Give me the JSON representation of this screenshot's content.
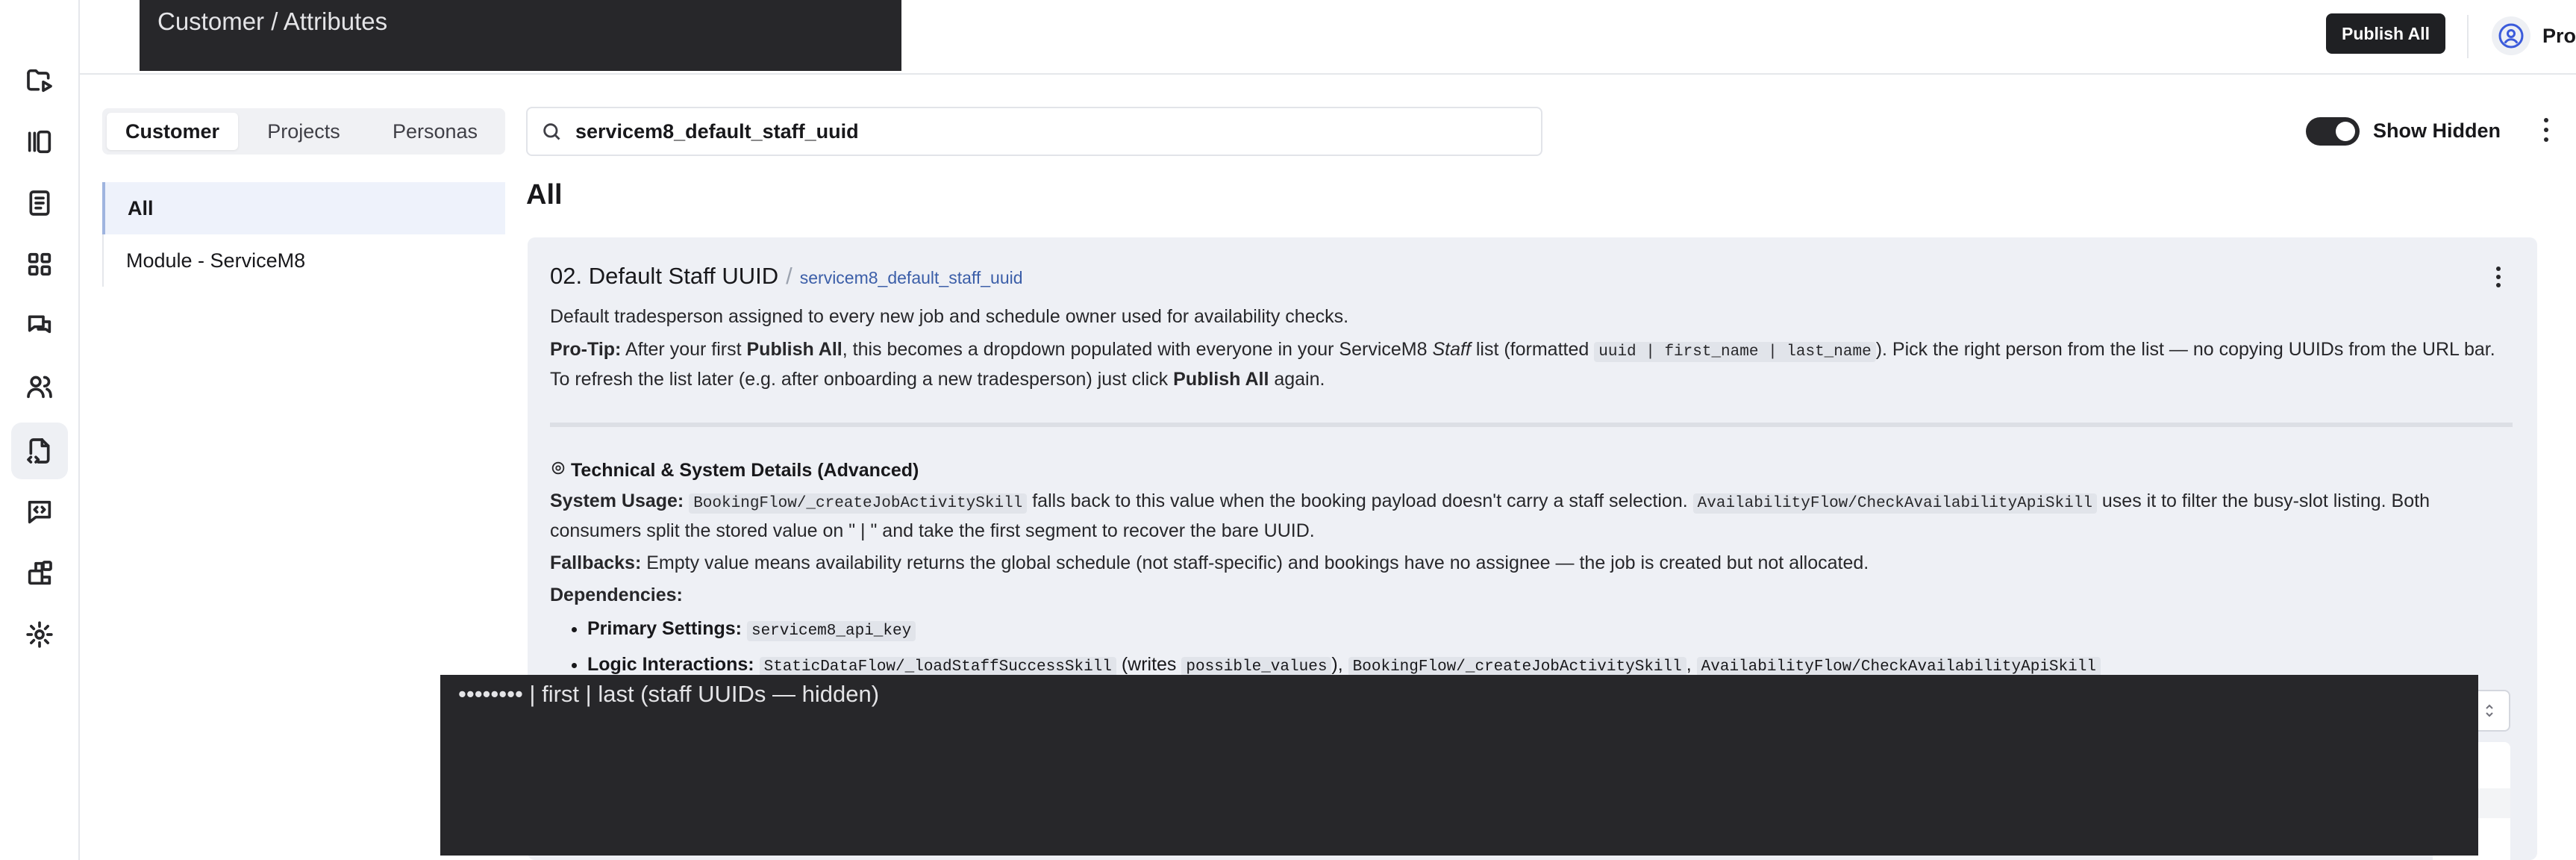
{
  "header": {
    "breadcrumb": "Customer / Attributes",
    "publish_all_label": "Publish All",
    "profile_label": "Profile"
  },
  "rail": {
    "icons": [
      "folder-play-icon",
      "library-icon",
      "book-icon",
      "grid-icon",
      "chat-icon",
      "users-icon",
      "file-script-icon",
      "message-code-icon",
      "blocks-icon",
      "settings-icon"
    ]
  },
  "left_panel": {
    "tabs": [
      "Customer",
      "Projects",
      "Personas"
    ],
    "active_tab": "Customer",
    "nav_items": [
      "All",
      "Module - ServiceM8"
    ]
  },
  "toolbar": {
    "search_value": "servicem8_default_staff_uuid",
    "show_hidden_label": "Show Hidden",
    "show_hidden_on": true
  },
  "main": {
    "section_heading": "All",
    "card": {
      "title": "02. Default Staff UUID",
      "key": "servicem8_default_staff_uuid",
      "description": "Default tradesperson assigned to every new job and schedule owner used for availability checks.",
      "protip": {
        "label": "Pro-Tip:",
        "t1": "After your first",
        "b1": "Publish All",
        "t2": ", this becomes a dropdown populated with everyone in your ServiceM8",
        "i1": "Staff",
        "t3": "list (formatted",
        "c1": "uuid | first_name | last_name",
        "t4": "). Pick the right person from the list — no copying UUIDs from the URL bar. To refresh the list later (e.g. after onboarding a new tradesperson) just click",
        "b2": "Publish All",
        "t5": "again."
      },
      "tech": {
        "heading": "Technical & System Details (Advanced)",
        "system_usage_label": "System Usage:",
        "su_c1": "BookingFlow/_createJobActivitySkill",
        "su_t1": "falls back to this value when the booking payload doesn't carry a staff selection.",
        "su_c2": "AvailabilityFlow/CheckAvailabilityApiSkill",
        "su_t2": "uses it to filter the busy-slot listing. Both consumers split the stored value on \" | \" and take the first segment to recover the bare UUID.",
        "fallbacks_label": "Fallbacks:",
        "fallbacks_text": "Empty value means availability returns the global schedule (not staff-specific) and bookings have no assignee — the job is created but not allocated.",
        "dependencies_label": "Dependencies:",
        "primary_settings_label": "Primary Settings:",
        "primary_settings_code": "servicem8_api_key",
        "logic_label": "Logic Interactions:",
        "logic_c1": "StaticDataFlow/_loadStaffSuccessSkill",
        "logic_t1": "(writes",
        "logic_c2": "possible_values",
        "logic_t2": "),",
        "logic_c3": "BookingFlow/_createJobActivitySkill",
        "logic_t3": ",",
        "logic_c4": "AvailabilityFlow/CheckAvailabilityApiSkill"
      }
    }
  },
  "overlay": {
    "bottom_text": "•••••••• | first | last (staff UUIDs — hidden)"
  }
}
